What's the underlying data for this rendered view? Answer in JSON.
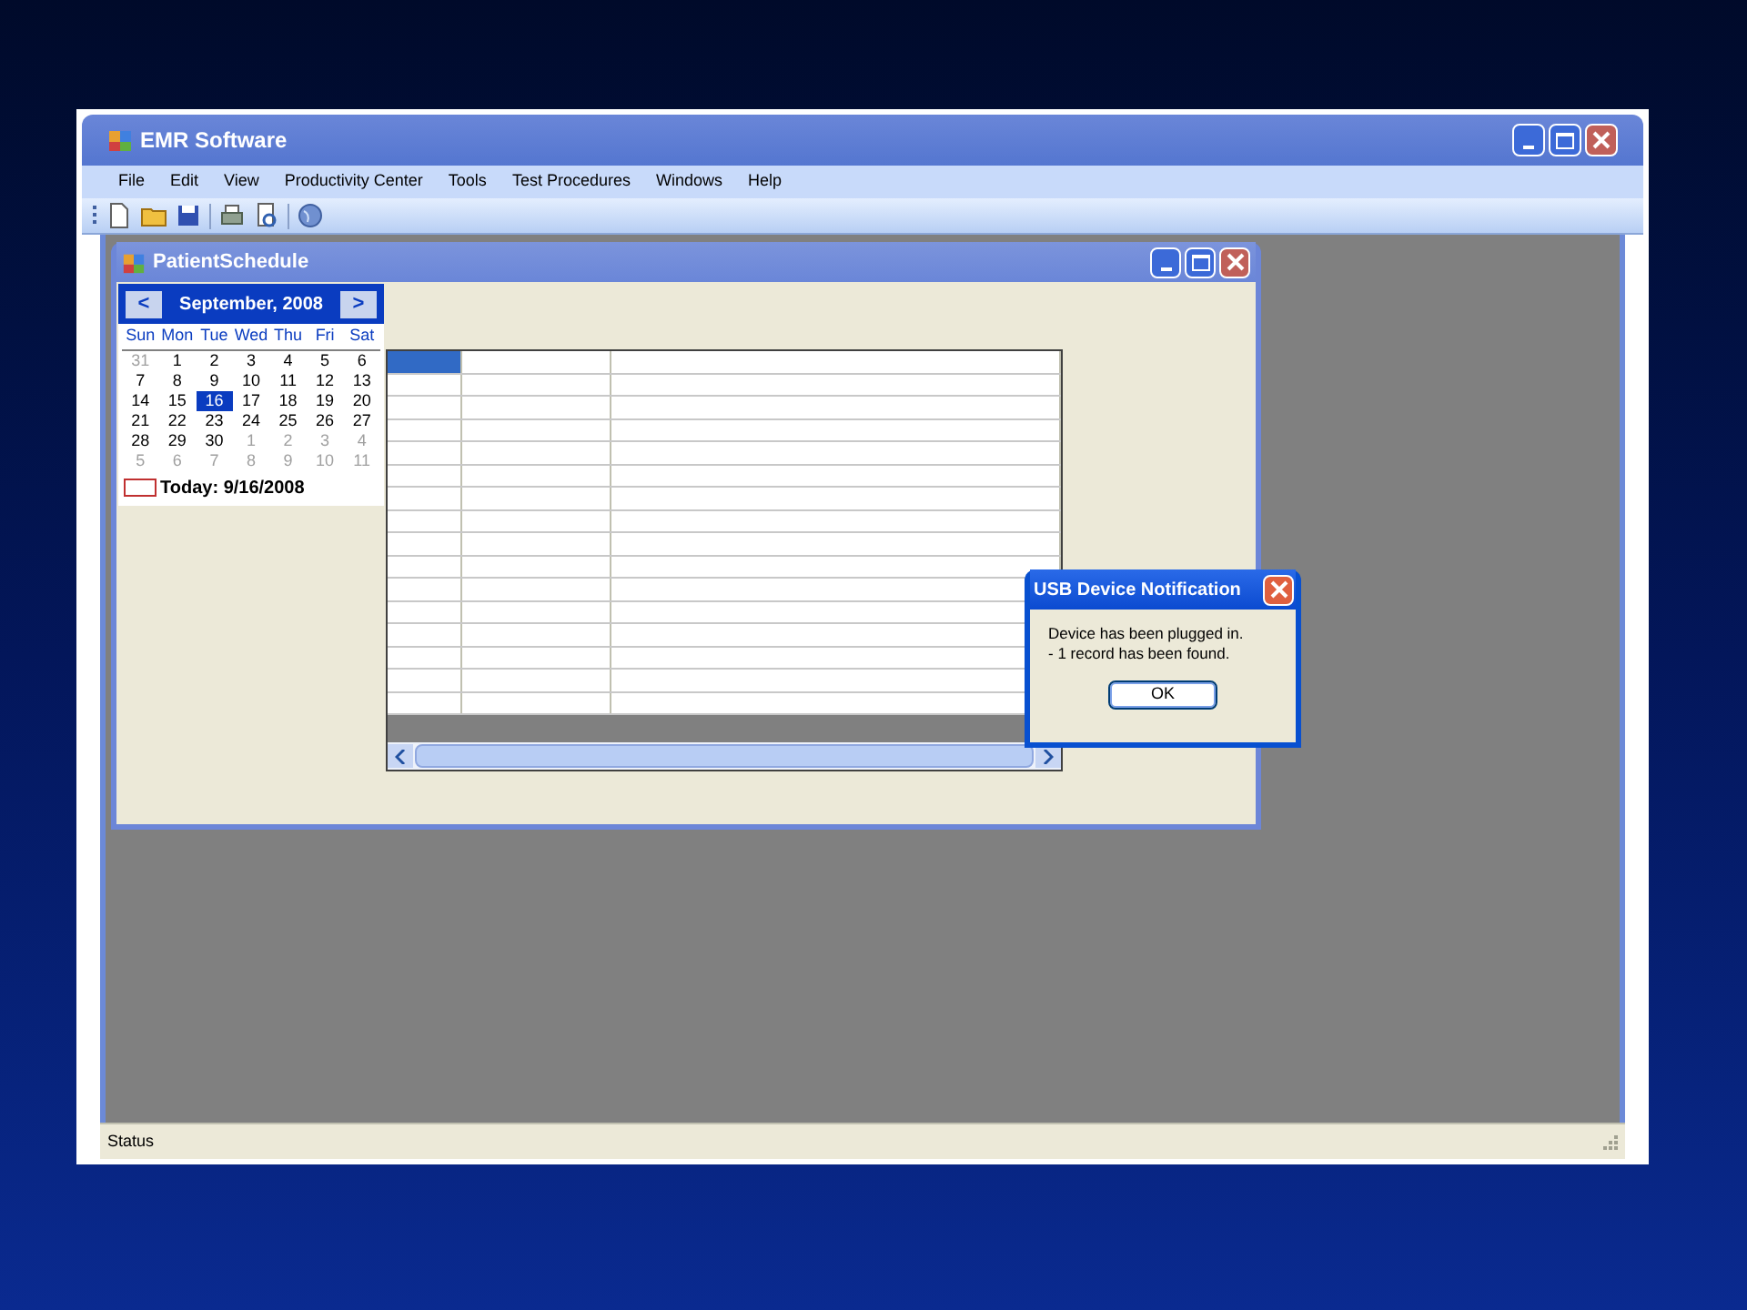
{
  "window": {
    "title": "EMR Software"
  },
  "menu": [
    "File",
    "Edit",
    "View",
    "Productivity Center",
    "Tools",
    "Test Procedures",
    "Windows",
    "Help"
  ],
  "toolbar": [
    {
      "kind": "new"
    },
    {
      "kind": "open"
    },
    {
      "kind": "save"
    },
    {
      "kind": "separator"
    },
    {
      "kind": "print"
    },
    {
      "kind": "preview"
    },
    {
      "kind": "separator"
    },
    {
      "kind": "globe"
    }
  ],
  "child_window": {
    "title": "PatientSchedule",
    "calendar": {
      "month": "September, 2008",
      "prev": "<",
      "next": ">",
      "weekdays": [
        "Sun",
        "Mon",
        "Tue",
        "Wed",
        "Thu",
        "Fri",
        "Sat"
      ],
      "weeks": [
        [
          {
            "day": "31",
            "muted": true,
            "selected": false
          },
          {
            "day": "1",
            "muted": false,
            "selected": false
          },
          {
            "day": "2",
            "muted": false,
            "selected": false
          },
          {
            "day": "3",
            "muted": false,
            "selected": false
          },
          {
            "day": "4",
            "muted": false,
            "selected": false
          },
          {
            "day": "5",
            "muted": false,
            "selected": false
          },
          {
            "day": "6",
            "muted": false,
            "selected": false
          }
        ],
        [
          {
            "day": "7",
            "muted": false,
            "selected": false
          },
          {
            "day": "8",
            "muted": false,
            "selected": false
          },
          {
            "day": "9",
            "muted": false,
            "selected": false
          },
          {
            "day": "10",
            "muted": false,
            "selected": false
          },
          {
            "day": "11",
            "muted": false,
            "selected": false
          },
          {
            "day": "12",
            "muted": false,
            "selected": false
          },
          {
            "day": "13",
            "muted": false,
            "selected": false
          }
        ],
        [
          {
            "day": "14",
            "muted": false,
            "selected": false
          },
          {
            "day": "15",
            "muted": false,
            "selected": false
          },
          {
            "day": "16",
            "muted": false,
            "selected": true
          },
          {
            "day": "17",
            "muted": false,
            "selected": false
          },
          {
            "day": "18",
            "muted": false,
            "selected": false
          },
          {
            "day": "19",
            "muted": false,
            "selected": false
          },
          {
            "day": "20",
            "muted": false,
            "selected": false
          }
        ],
        [
          {
            "day": "21",
            "muted": false,
            "selected": false
          },
          {
            "day": "22",
            "muted": false,
            "selected": false
          },
          {
            "day": "23",
            "muted": false,
            "selected": false
          },
          {
            "day": "24",
            "muted": false,
            "selected": false
          },
          {
            "day": "25",
            "muted": false,
            "selected": false
          },
          {
            "day": "26",
            "muted": false,
            "selected": false
          },
          {
            "day": "27",
            "muted": false,
            "selected": false
          }
        ],
        [
          {
            "day": "28",
            "muted": false,
            "selected": false
          },
          {
            "day": "29",
            "muted": false,
            "selected": false
          },
          {
            "day": "30",
            "muted": false,
            "selected": false
          },
          {
            "day": "1",
            "muted": true,
            "selected": false
          },
          {
            "day": "2",
            "muted": true,
            "selected": false
          },
          {
            "day": "3",
            "muted": true,
            "selected": false
          },
          {
            "day": "4",
            "muted": true,
            "selected": false
          }
        ],
        [
          {
            "day": "5",
            "muted": true,
            "selected": false
          },
          {
            "day": "6",
            "muted": true,
            "selected": false
          },
          {
            "day": "7",
            "muted": true,
            "selected": false
          },
          {
            "day": "8",
            "muted": true,
            "selected": false
          },
          {
            "day": "9",
            "muted": true,
            "selected": false
          },
          {
            "day": "10",
            "muted": true,
            "selected": false
          },
          {
            "day": "11",
            "muted": true,
            "selected": false
          }
        ]
      ],
      "today": "Today: 9/16/2008"
    },
    "grid": {
      "rows": [
        {
          "selected": true
        },
        {
          "selected": false
        },
        {
          "selected": false
        },
        {
          "selected": false
        },
        {
          "selected": false
        },
        {
          "selected": false
        },
        {
          "selected": false
        },
        {
          "selected": false
        },
        {
          "selected": false
        },
        {
          "selected": false
        },
        {
          "selected": false
        },
        {
          "selected": false
        },
        {
          "selected": false
        },
        {
          "selected": false
        },
        {
          "selected": false
        },
        {
          "selected": false
        }
      ]
    }
  },
  "dialog": {
    "title": "USB Device Notification",
    "message_lines": [
      "Device has been plugged in.",
      "- 1 record has been found."
    ],
    "button": "OK"
  },
  "status_bar": "Status"
}
